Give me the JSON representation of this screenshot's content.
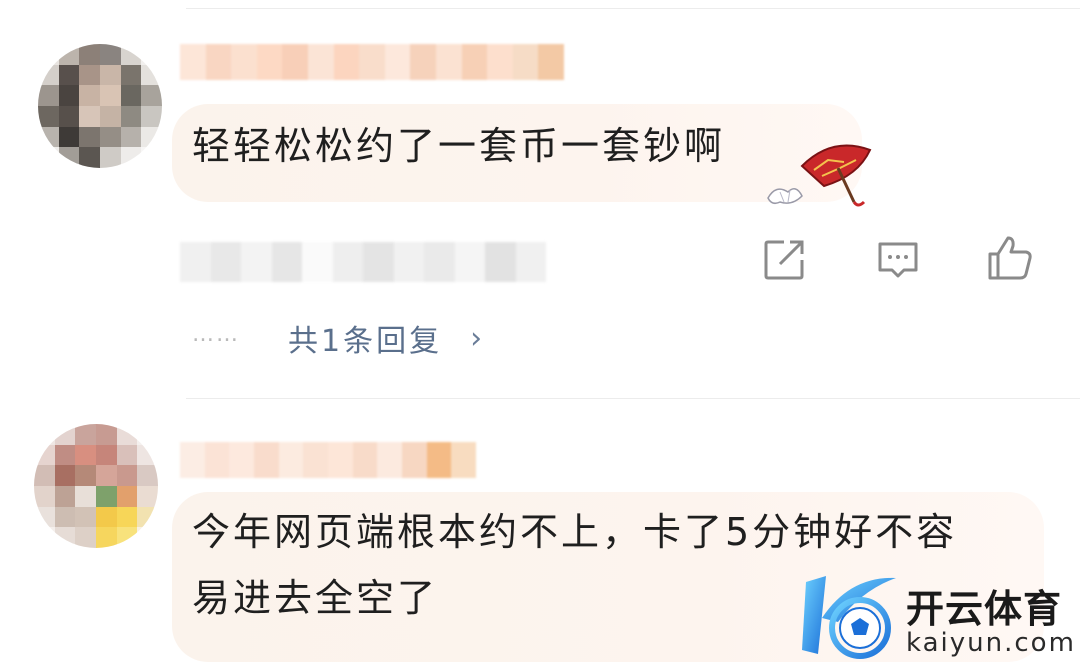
{
  "comments": [
    {
      "text": "轻轻松松约了一套币一套钞啊",
      "reply_dots": "……",
      "reply_label": "共1条回复",
      "reply_chevron": "›",
      "sticker": "red-umbrella-sticker"
    },
    {
      "text_line1": "今年网页端根本约不上，卡了5分钟好不容",
      "text_line2": "易进去全空了"
    }
  ],
  "actions": {
    "share_icon": "share-icon",
    "comment_icon": "comment-icon",
    "like_icon": "thumbs-up-icon"
  },
  "watermark": {
    "title": "开云体育",
    "subtitle": "kaiyun.com",
    "logo": "k-soccer-logo"
  },
  "colors": {
    "bubble": "#fbf3ec",
    "reply_link": "#5a6f8c",
    "icon_gray": "#8a8a8a",
    "logo_blue": "#2a8fe8"
  }
}
